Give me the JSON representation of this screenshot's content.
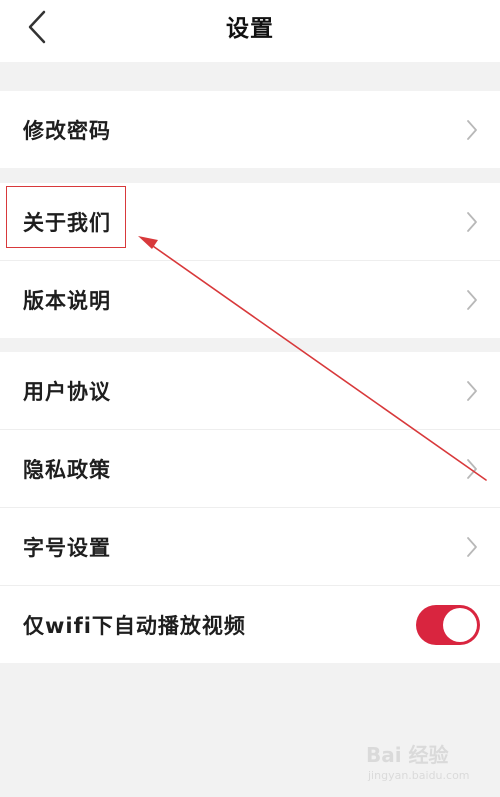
{
  "header": {
    "title": "设置"
  },
  "groups": [
    {
      "items": [
        {
          "label": "修改密码",
          "control": "chevron"
        }
      ]
    },
    {
      "items": [
        {
          "label": "关于我们",
          "control": "chevron"
        },
        {
          "label": "版本说明",
          "control": "chevron"
        }
      ]
    },
    {
      "items": [
        {
          "label": "用户协议",
          "control": "chevron"
        },
        {
          "label": "隐私政策",
          "control": "chevron"
        },
        {
          "label": "字号设置",
          "control": "chevron"
        },
        {
          "label": "仅wifi下自动播放视频",
          "control": "toggle",
          "enabled": true
        }
      ]
    }
  ],
  "colors": {
    "toggle_on": "#d9253f",
    "annotation": "#d8393b",
    "chevron": "#b8b8b8"
  },
  "icons": {
    "back": "chevron-left-icon",
    "row": "chevron-right-icon"
  },
  "watermark": {
    "logo": "Bai 经验",
    "url": "jingyan.baidu.com"
  }
}
